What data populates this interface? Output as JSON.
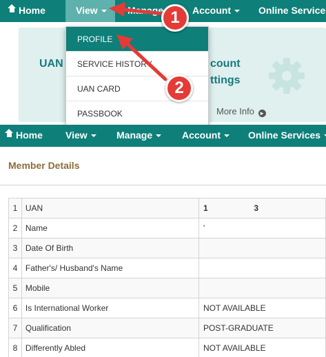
{
  "top_nav": {
    "items": [
      {
        "label": "Home"
      },
      {
        "label": "View"
      },
      {
        "label": "Manage"
      },
      {
        "label": "Account"
      },
      {
        "label": "Online Services"
      }
    ]
  },
  "banner": {
    "left_text": "UAN",
    "right_line1": "count",
    "right_line2": "ttings",
    "more_info": "More Info"
  },
  "dropdown": {
    "items": [
      {
        "label": "PROFILE"
      },
      {
        "label": "SERVICE HISTORY"
      },
      {
        "label": "UAN CARD"
      },
      {
        "label": "PASSBOOK"
      }
    ]
  },
  "annotations": {
    "badge1": "1",
    "badge2": "2"
  },
  "member": {
    "title": "Member Details",
    "rows": [
      {
        "idx": "1",
        "label": "UAN",
        "value": "1                    3"
      },
      {
        "idx": "2",
        "label": "Name",
        "value": "'"
      },
      {
        "idx": "3",
        "label": "Date Of Birth",
        "value": ""
      },
      {
        "idx": "4",
        "label": "Father's/ Husband's Name",
        "value": ""
      },
      {
        "idx": "5",
        "label": "Mobile",
        "value": ""
      },
      {
        "idx": "6",
        "label": "Is International Worker",
        "value": "NOT AVAILABLE"
      },
      {
        "idx": "7",
        "label": "Qualification",
        "value": "POST-GRADUATE"
      },
      {
        "idx": "8",
        "label": "Differently Abled",
        "value": "NOT AVAILABLE"
      }
    ]
  },
  "colors": {
    "nav_bg": "#0e7f79",
    "active_nav": "#5fb1ad",
    "annotation_red": "#e43b37",
    "section_title": "#8a6d3b"
  }
}
